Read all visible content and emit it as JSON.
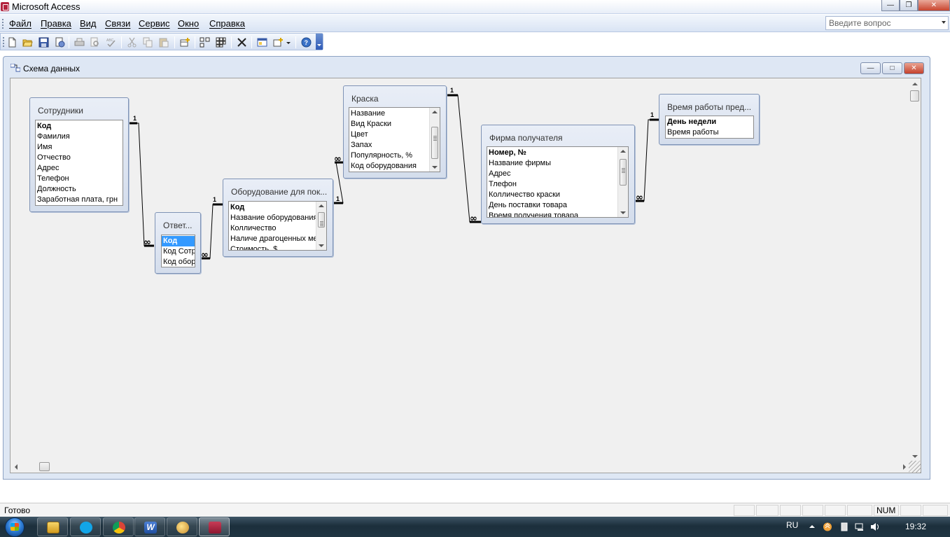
{
  "window": {
    "title": "Microsoft Access"
  },
  "menu": [
    {
      "label": "Файл"
    },
    {
      "label": "Правка"
    },
    {
      "label": "Вид"
    },
    {
      "label": "Связи"
    },
    {
      "label": "Сервис"
    },
    {
      "label": "Окно"
    },
    {
      "label": "Справка"
    }
  ],
  "help_box": {
    "placeholder": "Введите вопрос"
  },
  "toolbar": {
    "icons": [
      "new-icon",
      "open-icon",
      "save-icon",
      "print-setup-icon",
      "print-icon",
      "print-preview-icon",
      "spelling-icon",
      "cut-icon",
      "copy-icon",
      "paste-icon",
      "show-table-icon",
      "show-direct-icon",
      "show-all-icon",
      "delete-icon",
      "database-window-icon",
      "new-object-icon",
      "help-icon"
    ]
  },
  "child_window": {
    "title": "Схема данных"
  },
  "tables": [
    {
      "name": "Сотрудники",
      "fields": [
        "Код",
        "Фамилия",
        "Имя",
        "Отчество",
        "Адрес",
        "Телефон",
        "Должность",
        "Заработная плата, грн"
      ],
      "primary_key": "Код"
    },
    {
      "name": "Ответ...",
      "fields": [
        "Код",
        "Код Сотр",
        "Код обор"
      ],
      "primary_key": "Код",
      "selected": "Код"
    },
    {
      "name": "Оборудование для пок...",
      "fields": [
        "Код",
        "Название оборудования",
        "Колличество",
        "Наличе драгоценных ме",
        "Стоимость, $"
      ],
      "primary_key": "Код"
    },
    {
      "name": "Краска",
      "fields": [
        "Название",
        "Вид Краски",
        "Цвет",
        "Запах",
        "Популярность, %",
        "Код оборудования"
      ]
    },
    {
      "name": "Фирма получателя",
      "fields": [
        "Номер, №",
        "Название фирмы",
        "Адрес",
        "Тлефон",
        "Колличество краски",
        "День поставки товара",
        "Время получения товара"
      ],
      "primary_key": "Номер, №"
    },
    {
      "name": "Время работы пред...",
      "fields": [
        "День недели",
        "Время работы"
      ],
      "primary_key": "День недели"
    }
  ],
  "relations": {
    "one_label": "1",
    "many_label": "∞"
  },
  "statusbar": {
    "text": "Готово",
    "num": "NUM"
  },
  "taskbar": {
    "apps": [
      "explorer-icon",
      "skype-icon",
      "chrome-icon",
      "word-icon",
      "paint-icon",
      "access-icon"
    ],
    "language": "RU",
    "time": "19:32"
  }
}
